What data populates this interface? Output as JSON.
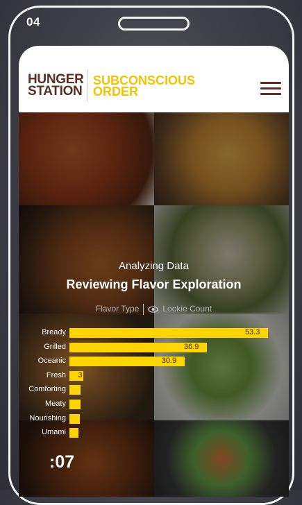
{
  "step_number": "04",
  "brand": {
    "line1": "HUNGER",
    "line2": "STATION"
  },
  "subtitle": {
    "line1": "SUBCONSCIOUS",
    "line2": "ORDER"
  },
  "status_text": "Analyzing Data",
  "heading": "Reviewing Flavor Exploration",
  "tabs": {
    "left": "Flavor Type",
    "right": "Lookie Count"
  },
  "timer": ":07",
  "colors": {
    "bar": "#ffd500",
    "brand": "#5b2e24",
    "accent": "#f3c300"
  },
  "chart_data": {
    "type": "bar",
    "orientation": "horizontal",
    "categories": [
      "Bready",
      "Grilled",
      "Oceanic",
      "Fresh",
      "Comforting",
      "Meaty",
      "Nourishing",
      "Umami"
    ],
    "values": [
      53.3,
      36.9,
      30.9,
      3.8,
      3.0,
      2.9,
      2.8,
      2.4
    ],
    "value_labels": [
      "53.3",
      "36.9",
      "30.9",
      "3",
      "",
      "",
      "",
      ""
    ]
  }
}
